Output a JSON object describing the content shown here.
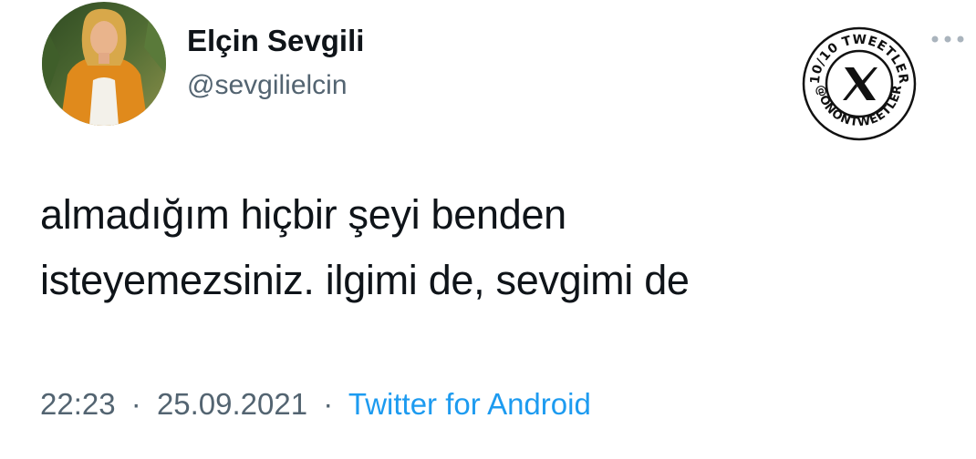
{
  "author": {
    "display_name": "Elçin Sevgili",
    "handle": "@sevgilielcin"
  },
  "badge": {
    "top_text": "10/10 TWEETLER",
    "bottom_text": "@ONONTWEETLER",
    "center_glyph": "X"
  },
  "tweet": {
    "lines": [
      "almadığım hiçbir şeyi benden",
      "isteyemezsiniz. ilgimi de, sevgimi de"
    ]
  },
  "meta": {
    "time": "22:23",
    "separator": "·",
    "date": "25.09.2021",
    "source": "Twitter for Android"
  },
  "icons": {
    "avatar": "profile-photo",
    "more": "more-horizontal-icon",
    "badge": "x-logo-stamp"
  },
  "colors": {
    "text_primary": "#0f1419",
    "text_secondary": "#536471",
    "link": "#1d9bf0",
    "background": "#ffffff"
  }
}
